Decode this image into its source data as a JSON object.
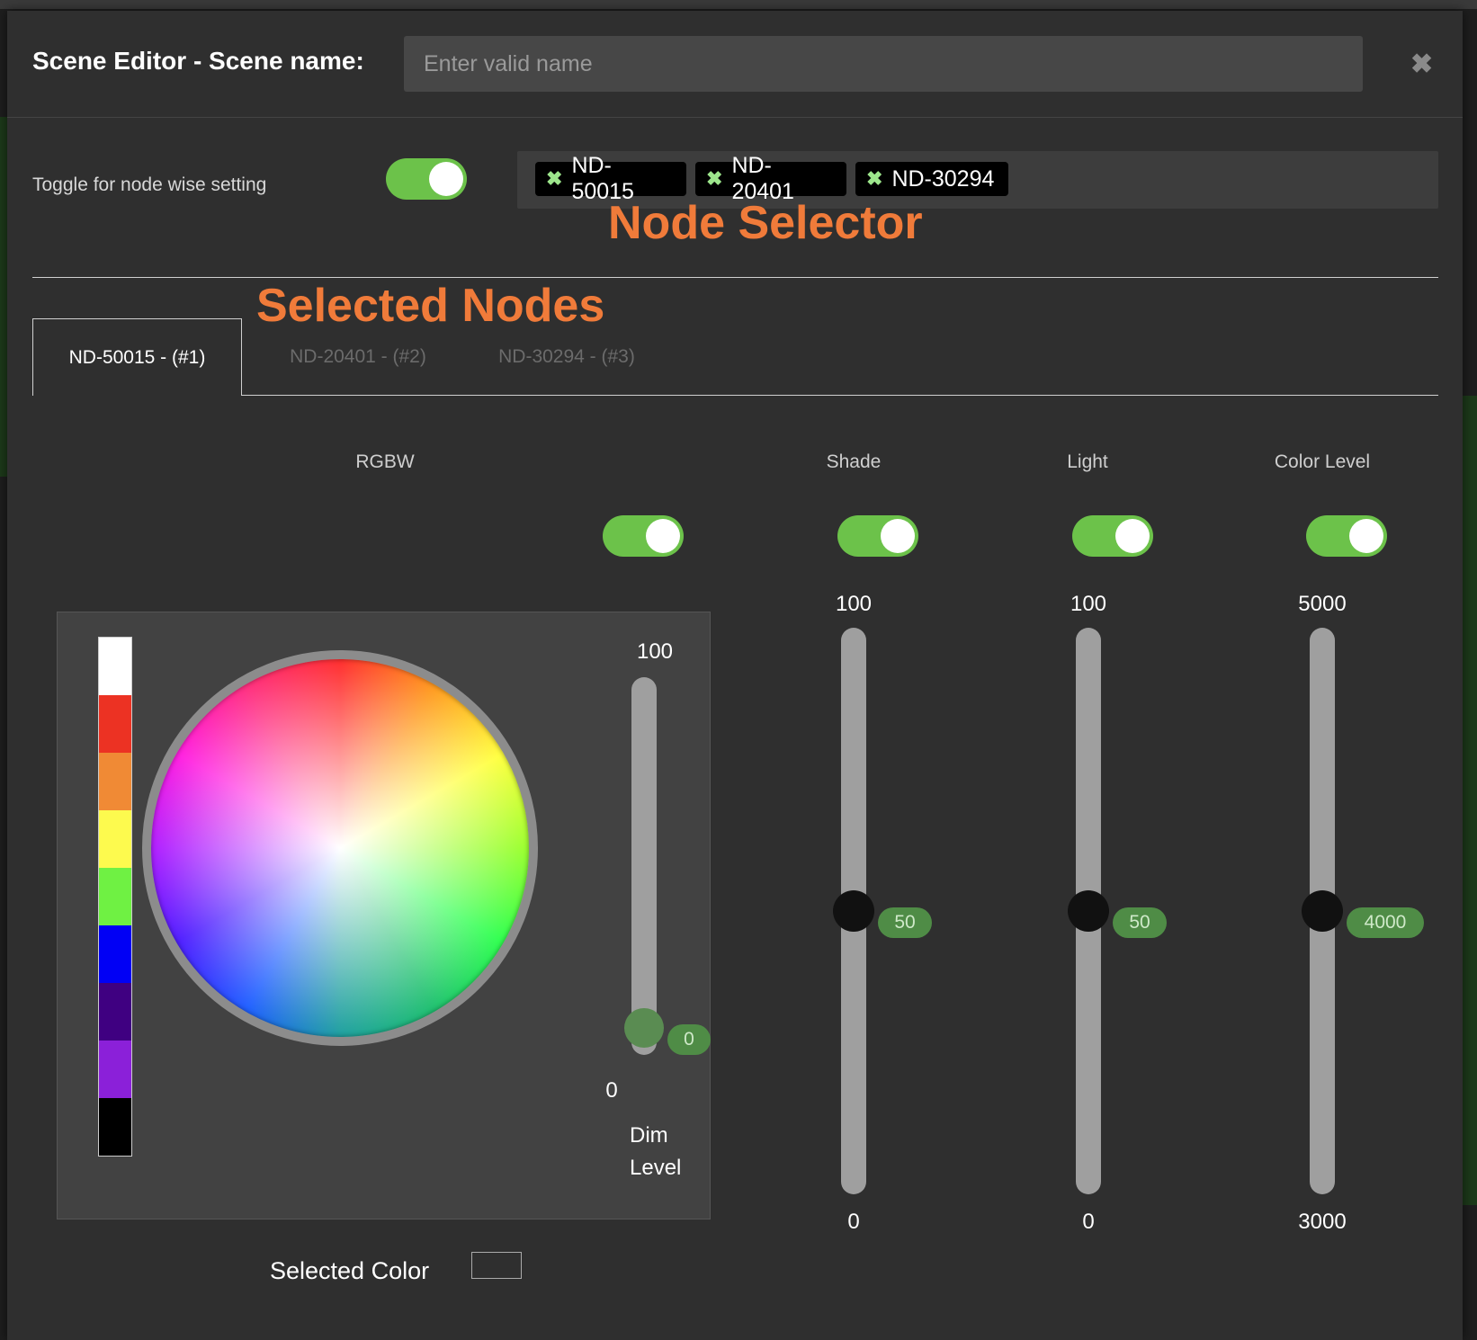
{
  "header": {
    "title": "Scene Editor - Scene name:",
    "name_placeholder": "Enter valid name",
    "close_glyph": "✖"
  },
  "node_wise": {
    "label": "Toggle for node wise setting",
    "enabled": true
  },
  "node_selector": {
    "chips": [
      {
        "label": "ND-50015",
        "remove_glyph": "✖"
      },
      {
        "label": "ND-20401",
        "remove_glyph": "✖"
      },
      {
        "label": "ND-30294",
        "remove_glyph": "✖"
      }
    ]
  },
  "annotations": {
    "node_selector": "Node Selector",
    "selected_nodes": "Selected Nodes"
  },
  "tabs": [
    {
      "label": "ND-50015 - (#1)",
      "active": true
    },
    {
      "label": "ND-20401 - (#2)",
      "active": false
    },
    {
      "label": "ND-30294 - (#3)",
      "active": false
    }
  ],
  "columns": {
    "rgbw": {
      "label": "RGBW",
      "enabled": true
    },
    "shade": {
      "label": "Shade",
      "enabled": true,
      "max": "100",
      "min": "0",
      "value": "50",
      "value_num": 50,
      "range": [
        0,
        100
      ]
    },
    "light": {
      "label": "Light",
      "enabled": true,
      "max": "100",
      "min": "0",
      "value": "50",
      "value_num": 50,
      "range": [
        0,
        100
      ]
    },
    "color_level": {
      "label": "Color Level",
      "enabled": true,
      "max": "5000",
      "min": "3000",
      "value": "4000",
      "value_num": 4000,
      "range": [
        3000,
        5000
      ]
    }
  },
  "rgbw": {
    "palette": [
      "#ffffff",
      "#ec3223",
      "#f08a35",
      "#fdfa4e",
      "#6ff143",
      "#0100f5",
      "#3f0081",
      "#8b20d9",
      "#000000"
    ],
    "dim": {
      "max": "100",
      "min": "0",
      "value": "0",
      "value_num": 0,
      "label_line1": "Dim",
      "label_line2": "Level"
    },
    "selected_color_label": "Selected Color"
  },
  "colors": {
    "accent_green": "#6cc24a",
    "annotation_orange": "#f07b3a",
    "badge_green": "#4f8c46"
  }
}
